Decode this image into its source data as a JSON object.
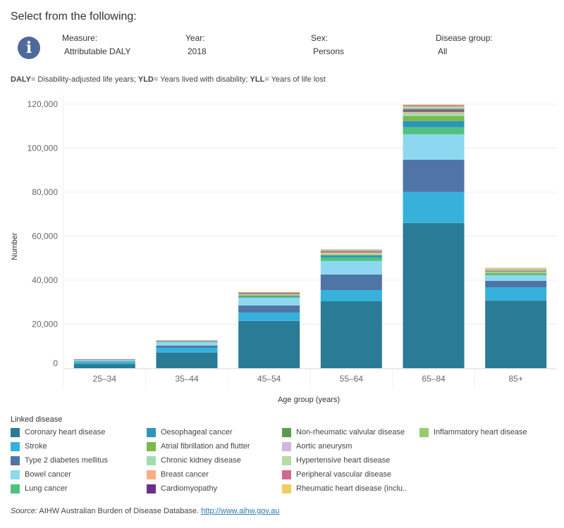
{
  "header": {
    "title": "Select from the following:",
    "filters": [
      {
        "label": "Measure:",
        "value": "Attributable DALY"
      },
      {
        "label": "Year:",
        "value": "2018"
      },
      {
        "label": "Sex:",
        "value": "Persons"
      },
      {
        "label": "Disease group:",
        "value": "All"
      }
    ],
    "info_icon": "info-icon"
  },
  "abbreviations": {
    "daly_key": "DALY",
    "daly_text": "= Disability-adjusted life years; ",
    "yld_key": "YLD",
    "yld_text": "= Years lived with disability; ",
    "yll_key": "YLL",
    "yll_text": "= Years of life lost"
  },
  "legend": {
    "title": "Linked disease"
  },
  "source": {
    "label": "Source:",
    "text": " AIHW Australian Burden of Disease Database. ",
    "link": "http://www.aihw.gov.au"
  },
  "chart_data": {
    "type": "bar",
    "stacked": true,
    "title": "",
    "xlabel": "Age group (years)",
    "ylabel": "Number",
    "ylim": [
      0,
      120000
    ],
    "yticks": [
      0,
      20000,
      40000,
      60000,
      80000,
      100000,
      120000
    ],
    "ytick_labels": [
      "0",
      "20,000",
      "40,000",
      "60,000",
      "80,000",
      "100,000",
      "120,000"
    ],
    "grid": true,
    "legend_position": "bottom",
    "categories": [
      "25–34",
      "35–44",
      "45–54",
      "55–64",
      "65–84",
      "85+"
    ],
    "series": [
      {
        "name": "Coronary heart disease",
        "color": "#2a7b96",
        "values": [
          1900,
          7100,
          21500,
          30400,
          66000,
          30700
        ]
      },
      {
        "name": "Stroke",
        "color": "#35b1dc",
        "values": [
          900,
          2200,
          3800,
          5100,
          14100,
          6100
        ]
      },
      {
        "name": "Type 2 diabetes mellitus",
        "color": "#4f75a6",
        "values": [
          300,
          1000,
          3200,
          7100,
          14700,
          2900
        ]
      },
      {
        "name": "Bowel cancer",
        "color": "#8dd8f0",
        "values": [
          400,
          1600,
          3500,
          6100,
          11500,
          2500
        ]
      },
      {
        "name": "Lung cancer",
        "color": "#4fc27f",
        "values": [
          200,
          100,
          500,
          1600,
          3200,
          400
        ]
      },
      {
        "name": "Oesophageal cancer",
        "color": "#2c96b8",
        "values": [
          0,
          0,
          300,
          900,
          2900,
          200
        ]
      },
      {
        "name": "Atrial fibrillation and flutter",
        "color": "#7ab94a",
        "values": [
          0,
          200,
          300,
          300,
          2200,
          600
        ]
      },
      {
        "name": "Chronic kidney disease",
        "color": "#9fdcb4",
        "values": [
          100,
          100,
          300,
          600,
          1400,
          400
        ]
      },
      {
        "name": "Breast cancer",
        "color": "#f9ad81",
        "values": [
          100,
          100,
          400,
          600,
          600,
          200
        ]
      },
      {
        "name": "Cardiomyopathy",
        "color": "#6b2f92",
        "values": [
          100,
          200,
          300,
          300,
          500,
          100
        ]
      },
      {
        "name": "Non-rheumatic valvular disease",
        "color": "#589d4e",
        "values": [
          0,
          0,
          100,
          200,
          800,
          300
        ]
      },
      {
        "name": "Aortic aneurysm",
        "color": "#d2b6de",
        "values": [
          0,
          0,
          100,
          200,
          600,
          200
        ]
      },
      {
        "name": "Hypertensive heart disease",
        "color": "#b7dba0",
        "values": [
          0,
          0,
          100,
          200,
          500,
          300
        ]
      },
      {
        "name": "Peripheral vascular disease",
        "color": "#d0698f",
        "values": [
          0,
          0,
          100,
          200,
          500,
          100
        ]
      },
      {
        "name": "Rheumatic heart disease (inclu..",
        "color": "#f0cd62",
        "values": [
          0,
          0,
          200,
          100,
          200,
          500
        ]
      },
      {
        "name": "Inflammatory heart disease",
        "color": "#98ca72",
        "values": [
          0,
          0,
          0,
          100,
          100,
          100
        ]
      }
    ]
  }
}
